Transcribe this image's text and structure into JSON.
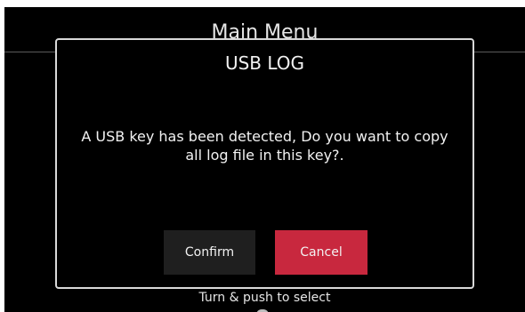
{
  "background": {
    "title": "Main Menu",
    "hint": "Turn & push to select"
  },
  "dialog": {
    "title": "USB LOG",
    "message": "A USB key has been detected, Do you want to copy all log file in this key?.",
    "confirm_label": "Confirm",
    "cancel_label": "Cancel"
  },
  "colors": {
    "screen_background": "#000000",
    "dialog_border": "#d9d9d9",
    "confirm_button": "#1f1f1f",
    "cancel_button": "#c8283e",
    "text": "#f2f2f2"
  }
}
